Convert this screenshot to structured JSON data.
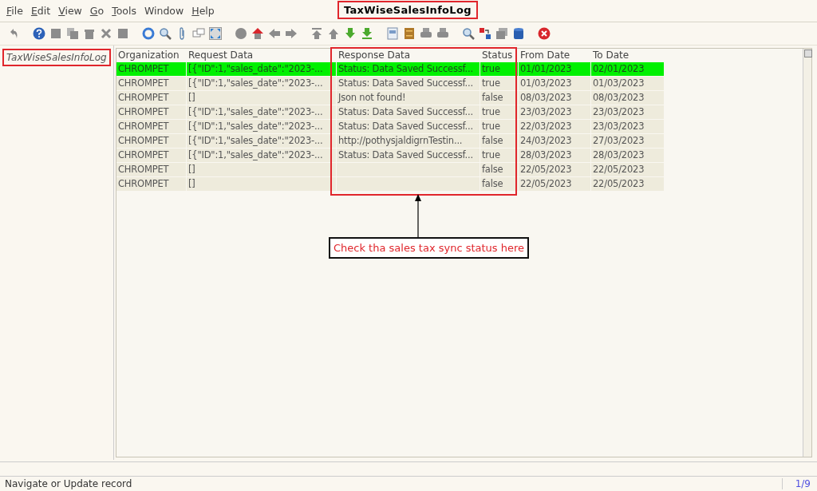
{
  "menu": [
    {
      "label": "File",
      "mnemonic": true
    },
    {
      "label": "Edit",
      "mnemonic": true
    },
    {
      "label": "View",
      "mnemonic": true
    },
    {
      "label": "Go",
      "mnemonic": true
    },
    {
      "label": "Tools",
      "mnemonic": true
    },
    {
      "label": "Window",
      "mnemonic": false
    },
    {
      "label": "Help",
      "mnemonic": true
    }
  ],
  "window": {
    "title": "TaxWiseSalesInfoLog"
  },
  "tabs": [
    {
      "label": "TaxWiseSalesInfoLog",
      "selected": true
    }
  ],
  "table": {
    "columns": [
      "Organization",
      "Request Data",
      "Response Data",
      "Status",
      "From Date",
      "To Date"
    ],
    "rows": [
      {
        "selected": true,
        "cells": [
          "CHROMPET",
          "[{\"ID\":1,\"sales_date\":\"2023-...",
          "Status: Data Saved Successf...",
          "true",
          "01/01/2023",
          "02/01/2023"
        ]
      },
      {
        "selected": false,
        "cells": [
          "CHROMPET",
          "[{\"ID\":1,\"sales_date\":\"2023-...",
          "Status: Data Saved Successf...",
          "true",
          "01/03/2023",
          "01/03/2023"
        ]
      },
      {
        "selected": false,
        "cells": [
          "CHROMPET",
          "[]",
          "Json not found!",
          "false",
          "08/03/2023",
          "08/03/2023"
        ]
      },
      {
        "selected": false,
        "cells": [
          "CHROMPET",
          "[{\"ID\":1,\"sales_date\":\"2023-...",
          "Status: Data Saved Successf...",
          "true",
          "23/03/2023",
          "23/03/2023"
        ]
      },
      {
        "selected": false,
        "cells": [
          "CHROMPET",
          "[{\"ID\":1,\"sales_date\":\"2023-...",
          "Status: Data Saved Successf...",
          "true",
          "22/03/2023",
          "23/03/2023"
        ]
      },
      {
        "selected": false,
        "cells": [
          "CHROMPET",
          "[{\"ID\":1,\"sales_date\":\"2023-...",
          "http://pothysjaldigrnTestin...",
          "false",
          "24/03/2023",
          "27/03/2023"
        ]
      },
      {
        "selected": false,
        "cells": [
          "CHROMPET",
          "[{\"ID\":1,\"sales_date\":\"2023-...",
          "Status: Data Saved Successf...",
          "true",
          "28/03/2023",
          "28/03/2023"
        ]
      },
      {
        "selected": false,
        "cells": [
          "CHROMPET",
          "[]",
          "",
          "false",
          "22/05/2023",
          "22/05/2023"
        ]
      },
      {
        "selected": false,
        "cells": [
          "CHROMPET",
          "[]",
          "",
          "false",
          "22/05/2023",
          "22/05/2023"
        ]
      }
    ]
  },
  "callout": "Check tha sales tax sync status here",
  "status_bar": {
    "message": "Navigate or Update record",
    "record": "1/9"
  }
}
